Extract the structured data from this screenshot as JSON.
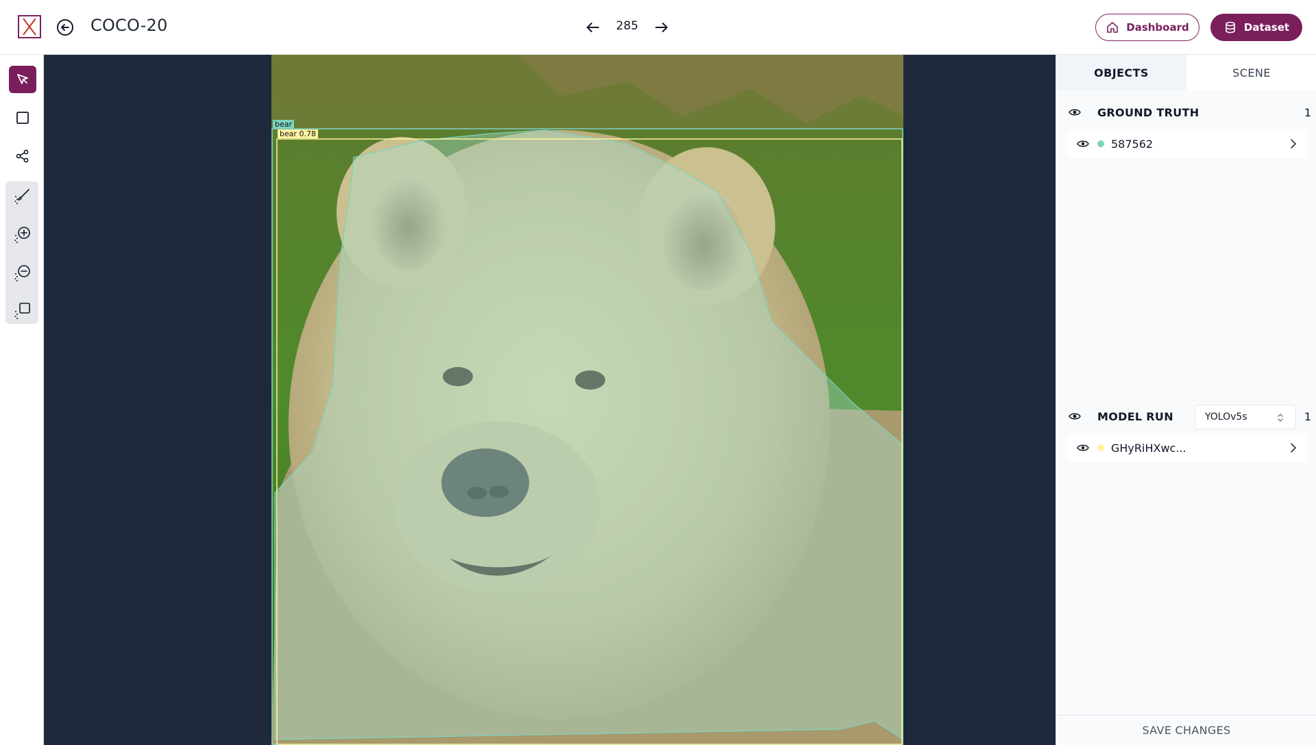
{
  "header": {
    "title": "COCO-20",
    "image_index": "285",
    "dashboard_label": "Dashboard",
    "dataset_label": "Dataset",
    "brand_color": "#7a1f5c"
  },
  "toolbar": {
    "tools": [
      {
        "name": "pointer-tool",
        "icon": "cursor-arrow-icon",
        "active": true
      },
      {
        "name": "bbox-tool",
        "icon": "square-icon",
        "active": false
      },
      {
        "name": "keypoint-tool",
        "icon": "share-nodes-icon",
        "active": false
      },
      {
        "name": "brush-tool",
        "icon": "magic-brush-icon",
        "active": false
      },
      {
        "name": "add-region-tool",
        "icon": "magic-plus-icon",
        "active": false
      },
      {
        "name": "remove-region-tool",
        "icon": "magic-minus-icon",
        "active": false
      },
      {
        "name": "magic-box-tool",
        "icon": "magic-square-icon",
        "active": false
      }
    ]
  },
  "canvas": {
    "annotations": [
      {
        "label": "bear",
        "color": "#7dd3c0",
        "source": "ground-truth"
      },
      {
        "label": "bear 0.78",
        "color": "#fef3a0",
        "source": "model-run"
      }
    ]
  },
  "panel": {
    "tabs": [
      {
        "label": "OBJECTS",
        "active": true
      },
      {
        "label": "SCENE",
        "active": false
      }
    ],
    "ground_truth": {
      "title": "GROUND TRUTH",
      "count": "1",
      "items": [
        {
          "label": "587562",
          "color": "#7dd3c0"
        }
      ]
    },
    "model_run": {
      "title": "MODEL RUN",
      "count": "1",
      "selected_model": "YOLOv5s",
      "items": [
        {
          "label": "GHyRiHXwc...",
          "color": "#fef3a0"
        }
      ]
    },
    "save_label": "SAVE CHANGES"
  }
}
